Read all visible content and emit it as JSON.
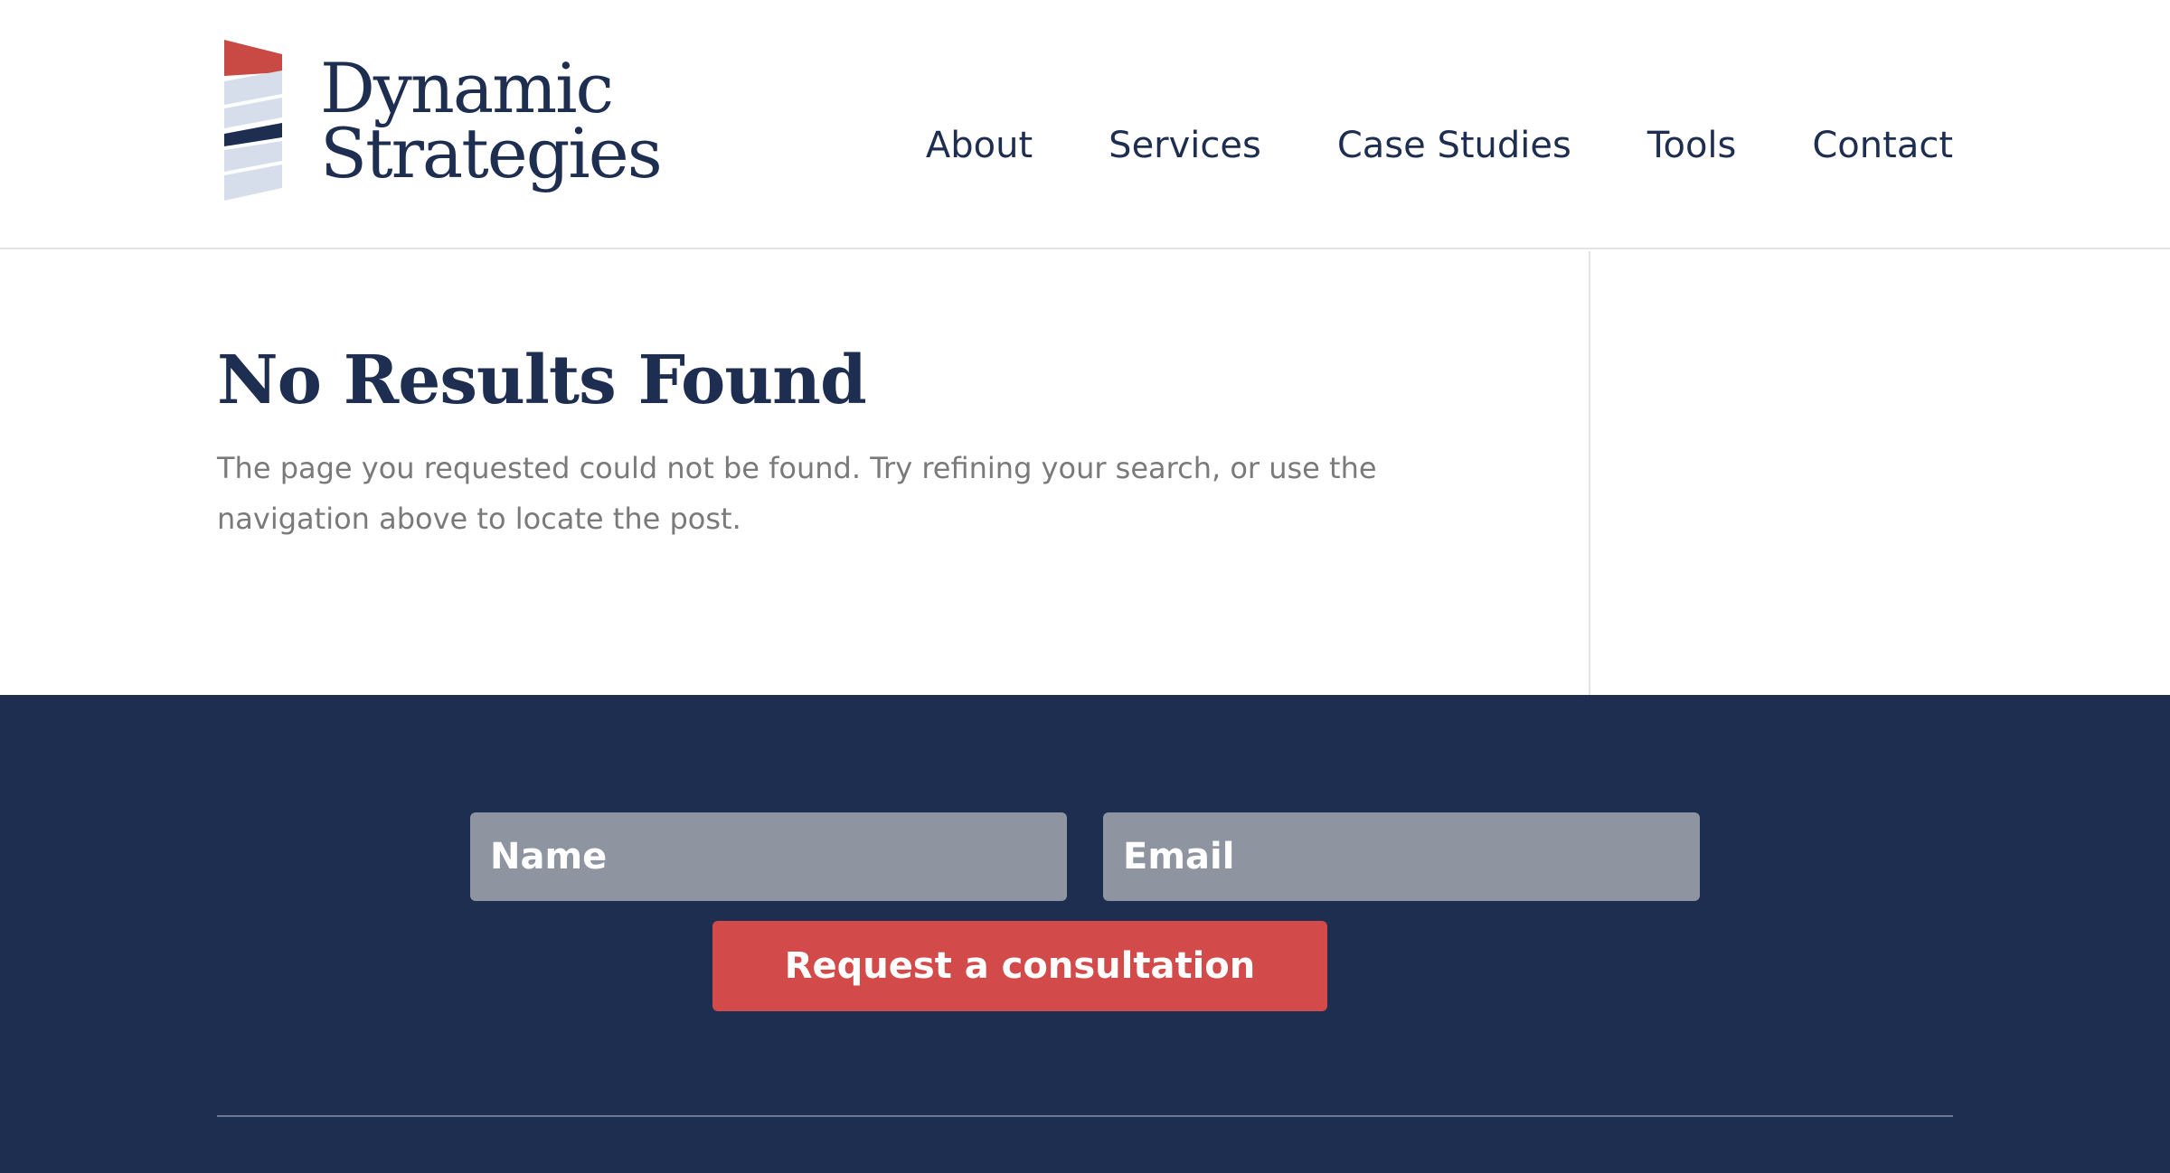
{
  "brand": {
    "line1": "Dynamic",
    "line2": "Strategies",
    "colors": {
      "navy": "#1e2e50",
      "red": "#d24a49",
      "light_blue": "#d7deeb"
    }
  },
  "nav": {
    "items": [
      {
        "label": "About"
      },
      {
        "label": "Services"
      },
      {
        "label": "Case Studies"
      },
      {
        "label": "Tools"
      },
      {
        "label": "Contact"
      }
    ]
  },
  "main": {
    "title": "No Results Found",
    "message": "The page you requested could not be found. Try refining your search, or use the navigation above to locate the post."
  },
  "footer": {
    "background": "#1e2e50",
    "form": {
      "name_placeholder": "Name",
      "email_placeholder": "Email",
      "submit_label": "Request a consultation"
    }
  }
}
